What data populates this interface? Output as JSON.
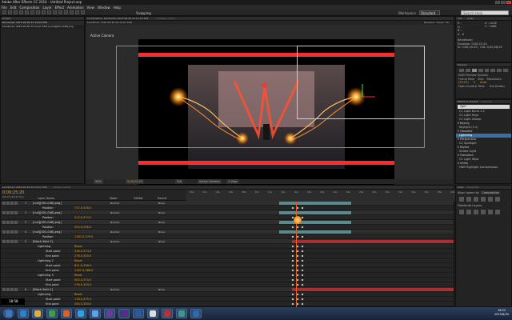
{
  "window": {
    "title": "Adobe After Effects CC 2014 - Untitled Project.aep"
  },
  "menu": [
    "File",
    "Edit",
    "Composition",
    "Layer",
    "Effect",
    "Animation",
    "View",
    "Window",
    "Help"
  ],
  "toolbar": {
    "snapping_label": "Snapping",
    "workspace_label": "Workspace",
    "workspace_value": "Standard",
    "search_placeholder": "Search Help"
  },
  "project_panel": {
    "header": "Project",
    "item": "Bandimain 2015-06-30 23-14-05-558",
    "item2": "bandimain 2015-06-30 23-14-07-558 x [null][001-048].png"
  },
  "comp_panel": {
    "tab": "Composition: bandimain 2015-06-30 23-14-07-558",
    "tab2": "Footage: (none)",
    "sub_tab": "bandimain 2015-06-30 23-14-07-558",
    "renderer": "Renderer: Classic 3D",
    "active_camera": "Active Camera",
    "zoom": "50%",
    "timecode": "0;00;25;20",
    "resolution": "Full",
    "view": "Active Camera",
    "views": "1 View"
  },
  "info_panel": {
    "header": "Info",
    "header2": "Audio",
    "r": "R :",
    "g": "G :",
    "b": "B :",
    "a": "A : 0",
    "x": "X : 1226",
    "y": "Y : 1086",
    "line1": "Bandimain",
    "line2": "Duration: 0;00;21;24",
    "line3": "In: 0;00;25;20 , Out: 0;00;28;23"
  },
  "preview_panel": {
    "header": "Preview",
    "ram_label": "RAM Preview Options",
    "frame_rate_label": "Frame Rate",
    "skip_label": "Skip",
    "resolution_label": "Resolution",
    "frame_rate": "(29.97)",
    "skip": "0",
    "resolution": "Auto",
    "from_current": "From Current Time",
    "full_screen": "Full Screen"
  },
  "effects_panel": {
    "header": "Effects & Presets",
    "header2": "Characte",
    "search_value": "light",
    "items": [
      {
        "kind": "item",
        "label": "CC Light Burst 2.5"
      },
      {
        "kind": "item",
        "label": "CC Light Rays"
      },
      {
        "kind": "item",
        "label": "CC Light Sweep"
      },
      {
        "kind": "cat",
        "label": "Keying"
      },
      {
        "kind": "item",
        "label": "Keylight (1.2)"
      },
      {
        "kind": "cat",
        "label": "Obsolete"
      },
      {
        "kind": "item",
        "label": "Lightning",
        "selected": true
      },
      {
        "kind": "cat",
        "label": "Perspective"
      },
      {
        "kind": "item",
        "label": "CC Spotlight"
      },
      {
        "kind": "cat",
        "label": "Stylize"
      },
      {
        "kind": "item",
        "label": "Strobe Light"
      },
      {
        "kind": "cat",
        "label": "Transition"
      },
      {
        "kind": "item",
        "label": "CC Light Wipe"
      },
      {
        "kind": "cat",
        "label": "Utility"
      },
      {
        "kind": "item",
        "label": "HDR Highlight Compression"
      }
    ]
  },
  "align_panel": {
    "header": "Align",
    "header2": "Paragraph",
    "align_to_label": "Align Layers to:",
    "align_to_value": "Composition",
    "distribute_label": "Distribute Layers:"
  },
  "timeline": {
    "tab": "bandimain 2015-06-30 23-14-07-558",
    "tab2": "Render Queue",
    "timecode": "0;00;25;20",
    "fps": "00770 (29.97 fps)",
    "col_layer_name": "Layer Name",
    "col_mode": "Mode",
    "col_trkmat": "TrkMat",
    "col_parent": "Parent",
    "mode_normal": "Normal",
    "parent_none": "None",
    "ruler_labels": [
      "00s",
      "02s",
      "04s",
      "06s",
      "08s",
      "10s",
      "12s",
      "14s",
      "16s",
      "18s",
      "20s",
      "22s",
      "24s",
      "26s",
      "28s",
      "30s",
      "32s",
      "34s",
      "36s",
      "38s",
      "40s"
    ],
    "rows": [
      {
        "num": "1",
        "name": "[null][001-048].png]",
        "kind": "layer"
      },
      {
        "num": "",
        "name": "Position",
        "value": "717.0,378.0",
        "kind": "prop"
      },
      {
        "num": "2",
        "name": "[null][001-048].png]",
        "kind": "layer"
      },
      {
        "num": "",
        "name": "Position",
        "value": "513.0,374.0",
        "kind": "prop"
      },
      {
        "num": "3",
        "name": "[null][001-048].png]",
        "kind": "layer"
      },
      {
        "num": "",
        "name": "Position",
        "value": "320.0,296.0",
        "kind": "prop"
      },
      {
        "num": "4",
        "name": "[null][001-048].png]",
        "kind": "layer"
      },
      {
        "num": "",
        "name": "Position",
        "value": "1187.0,379.0",
        "kind": "prop"
      },
      {
        "num": "5",
        "name": "[Black Solid 1]",
        "kind": "solid"
      },
      {
        "num": "",
        "name": "Lightning",
        "value": "Reset",
        "kind": "fx"
      },
      {
        "num": "",
        "name": "Start point",
        "value": "518.0,374.0",
        "kind": "prop2"
      },
      {
        "num": "",
        "name": "End point",
        "value": "276.0,300.0",
        "kind": "prop2"
      },
      {
        "num": "",
        "name": "Lightning 2",
        "value": "Reset",
        "kind": "fx"
      },
      {
        "num": "",
        "name": "Start point",
        "value": "621.0,396.0",
        "kind": "prop2"
      },
      {
        "num": "",
        "name": "End point",
        "value": "1167.0,386.0",
        "kind": "prop2"
      },
      {
        "num": "",
        "name": "Lightning 3",
        "value": "Reset",
        "kind": "fx"
      },
      {
        "num": "",
        "name": "Start point",
        "value": "502.0,374.0",
        "kind": "prop2"
      },
      {
        "num": "",
        "name": "End point",
        "value": "276.0,300.0",
        "kind": "prop2"
      },
      {
        "num": "6",
        "name": "[Black Solid 1]",
        "kind": "solid"
      },
      {
        "num": "",
        "name": "Lightning",
        "value": "Reset",
        "kind": "fx"
      },
      {
        "num": "",
        "name": "Start point",
        "value": "718.0,375.0",
        "kind": "prop2"
      },
      {
        "num": "",
        "name": "End point",
        "value": "200.0,300.0",
        "kind": "prop2"
      }
    ],
    "overlay_time": "18:58"
  },
  "taskbar": {
    "time": "18:22",
    "date": "2015/6/30",
    "apps": [
      "start",
      "ie",
      "explorer",
      "media",
      "firefox",
      "chrome",
      "qq",
      "pr",
      "ae",
      "ps",
      "app11",
      "app12",
      "app13",
      "app14"
    ]
  },
  "colors": {
    "accent": "#e0a030",
    "selection": "#3a6ea5",
    "laser": "#ff3030",
    "layer_teal": "#5a8a8e",
    "solid_red": "#a83030"
  }
}
